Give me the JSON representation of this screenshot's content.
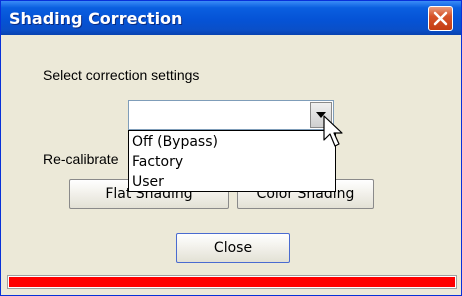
{
  "window": {
    "title": "Shading Correction"
  },
  "settings": {
    "prompt": "Select correction settings",
    "selected_value": "",
    "options": [
      "Off (Bypass)",
      "Factory",
      "User"
    ]
  },
  "recalibrate": {
    "label": "Re-calibrate"
  },
  "buttons": {
    "flat_shading": "Flat Shading",
    "color_shading": "Color Shading",
    "close": "Close"
  },
  "progress": {
    "fraction": 1.0
  },
  "colors": {
    "progress_fill": "#ff0000",
    "title_bar": "#0553d6"
  }
}
